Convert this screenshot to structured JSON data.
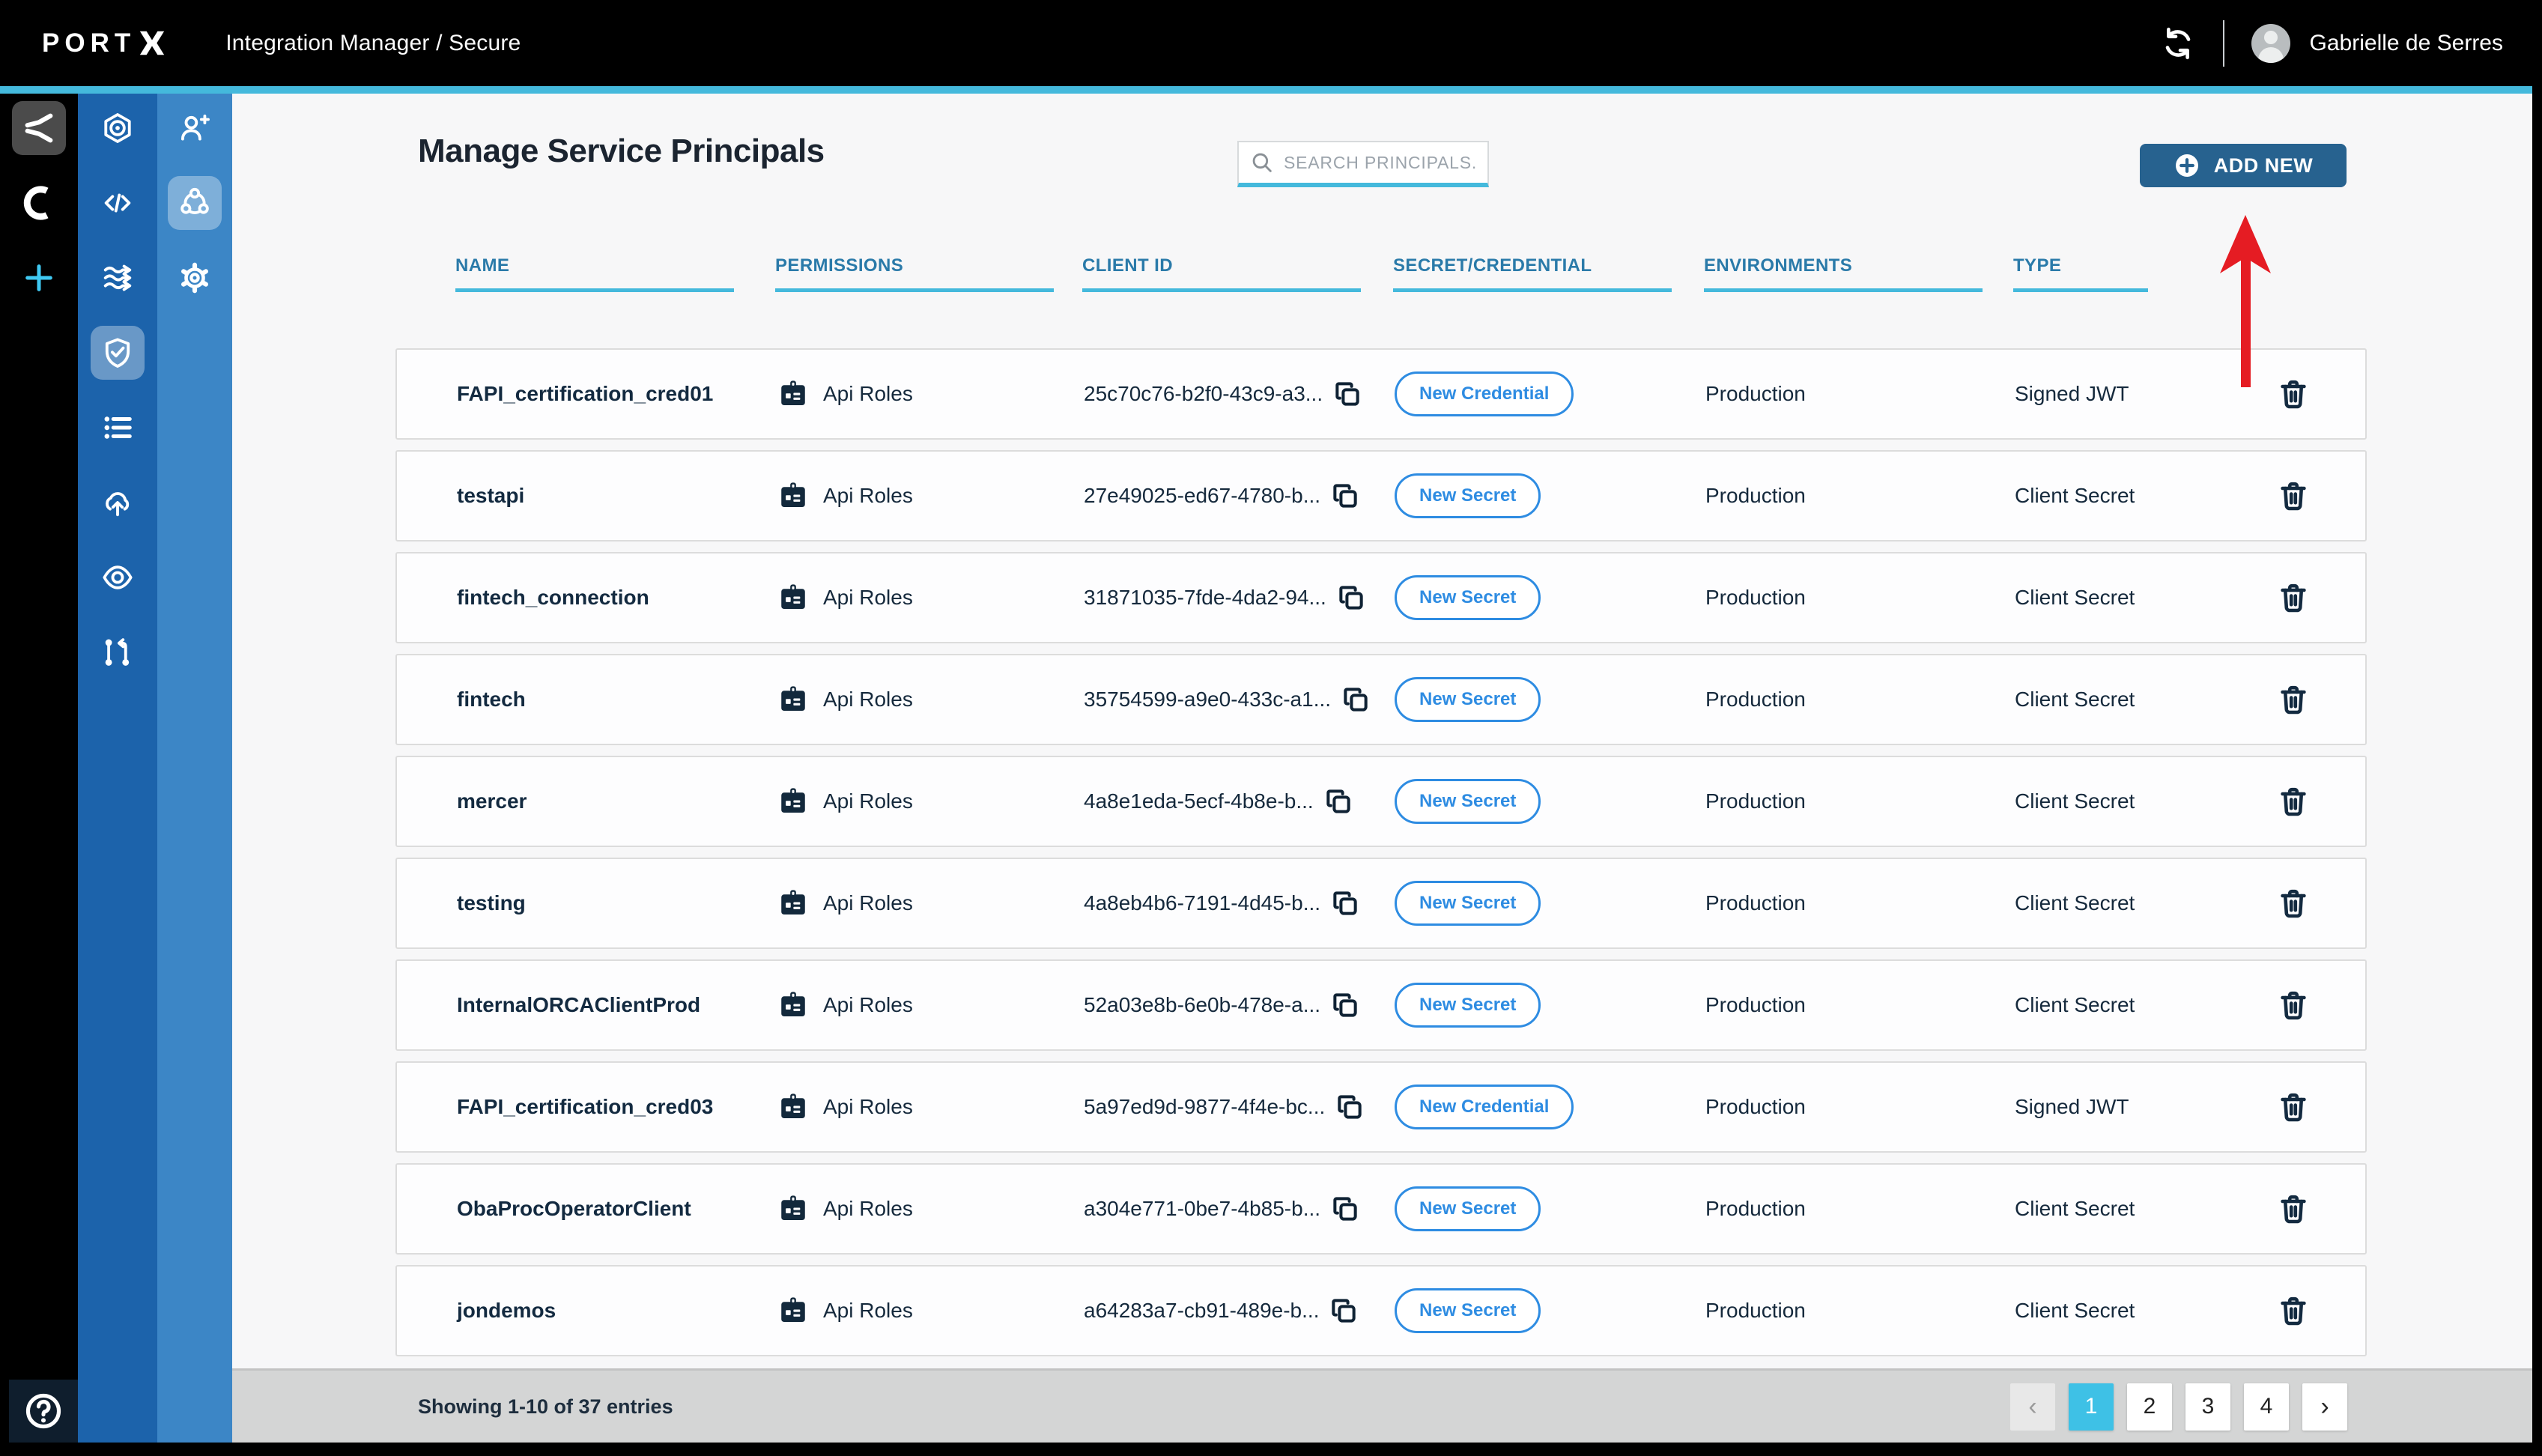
{
  "topbar": {
    "logo_text": "PORT",
    "logo_mark_icon": "portx-x-mark",
    "breadcrumb": "Integration Manager / Secure",
    "refresh_icon": "refresh-icon",
    "avatar_icon": "user-avatar",
    "user_name": "Gabrielle de Serres"
  },
  "sidebar": {
    "app_rail": [
      {
        "icon": "portx-mark-icon",
        "selected": true
      },
      {
        "icon": "orca-icon",
        "selected": false
      },
      {
        "icon": "plus-icon",
        "selected": false,
        "accent": true
      }
    ],
    "module_rail": [
      {
        "icon": "hex-node-icon",
        "selected": false
      },
      {
        "icon": "code-icon",
        "selected": false
      },
      {
        "icon": "streams-icon",
        "selected": false
      },
      {
        "icon": "shield-check-icon",
        "selected": true
      },
      {
        "icon": "list-icon",
        "selected": false
      },
      {
        "icon": "cloud-upload-icon",
        "selected": false
      },
      {
        "icon": "eye-icon",
        "selected": false
      },
      {
        "icon": "git-branch-icon",
        "selected": false
      }
    ],
    "section_rail": [
      {
        "icon": "user-plus-icon",
        "selected": false
      },
      {
        "icon": "mesh-icon",
        "selected": true
      },
      {
        "icon": "gear-icon",
        "selected": false
      }
    ],
    "help_icon": "help-icon"
  },
  "page": {
    "title": "Manage Service Principals",
    "search_placeholder": "SEARCH PRINCIPALS...",
    "search_icon": "search-icon",
    "add_new_label": "ADD NEW",
    "add_new_icon": "plus-circle-icon",
    "annotation": "red-arrow-pointing-to-add-new"
  },
  "table": {
    "columns": [
      "NAME",
      "PERMISSIONS",
      "CLIENT ID",
      "SECRET/CREDENTIAL",
      "ENVIRONMENTS",
      "TYPE"
    ],
    "permissions_icon": "id-badge-icon",
    "copy_icon": "copy-icon",
    "delete_icon": "trash-icon",
    "rows": [
      {
        "name": "FAPI_certification_cred01",
        "permissions": "Api Roles",
        "client_id": "25c70c76-b2f0-43c9-a3...",
        "secret_action": "New Credential",
        "environments": "Production",
        "type": "Signed JWT"
      },
      {
        "name": "testapi",
        "permissions": "Api Roles",
        "client_id": "27e49025-ed67-4780-b...",
        "secret_action": "New Secret",
        "environments": "Production",
        "type": "Client Secret"
      },
      {
        "name": "fintech_connection",
        "permissions": "Api Roles",
        "client_id": "31871035-7fde-4da2-94...",
        "secret_action": "New Secret",
        "environments": "Production",
        "type": "Client Secret"
      },
      {
        "name": "fintech",
        "permissions": "Api Roles",
        "client_id": "35754599-a9e0-433c-a1...",
        "secret_action": "New Secret",
        "environments": "Production",
        "type": "Client Secret"
      },
      {
        "name": "mercer",
        "permissions": "Api Roles",
        "client_id": "4a8e1eda-5ecf-4b8e-b...",
        "secret_action": "New Secret",
        "environments": "Production",
        "type": "Client Secret"
      },
      {
        "name": "testing",
        "permissions": "Api Roles",
        "client_id": "4a8eb4b6-7191-4d45-b...",
        "secret_action": "New Secret",
        "environments": "Production",
        "type": "Client Secret"
      },
      {
        "name": "InternalORCAClientProd",
        "permissions": "Api Roles",
        "client_id": "52a03e8b-6e0b-478e-a...",
        "secret_action": "New Secret",
        "environments": "Production",
        "type": "Client Secret"
      },
      {
        "name": "FAPI_certification_cred03",
        "permissions": "Api Roles",
        "client_id": "5a97ed9d-9877-4f4e-bc...",
        "secret_action": "New Credential",
        "environments": "Production",
        "type": "Signed JWT"
      },
      {
        "name": "ObaProcOperatorClient",
        "permissions": "Api Roles",
        "client_id": "a304e771-0be7-4b85-b...",
        "secret_action": "New Secret",
        "environments": "Production",
        "type": "Client Secret"
      },
      {
        "name": "jondemos",
        "permissions": "Api Roles",
        "client_id": "a64283a7-cb91-489e-b...",
        "secret_action": "New Secret",
        "environments": "Production",
        "type": "Client Secret"
      }
    ]
  },
  "footer": {
    "showing": "Showing 1-10 of 37 entries",
    "prev_label": "‹",
    "next_label": "›",
    "pages": [
      "1",
      "2",
      "3",
      "4"
    ],
    "active_page": "1"
  },
  "colors": {
    "accent_cyan": "#44b9dc",
    "rail_mid_blue": "#1c63ab",
    "rail_light_blue": "#3c86c6",
    "button_blue": "#27628f",
    "pill_blue": "#2e8ce2",
    "header_teal": "#2a7aa9",
    "text_navy": "#15293c",
    "active_page_cyan": "#3ec1e6",
    "arrow_red": "#e51c23"
  }
}
